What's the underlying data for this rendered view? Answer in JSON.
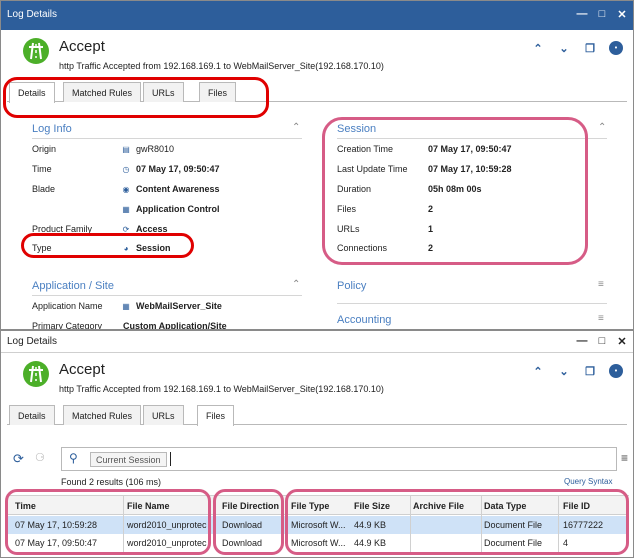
{
  "window1": {
    "title": "Log Details",
    "header": {
      "title": "Accept",
      "subtitle": "http Traffic Accepted from 192.168.169.1 to WebMailServer_Site(192.168.170.10)"
    },
    "tabs": [
      {
        "label": "Details",
        "active": true
      },
      {
        "label": "Matched Rules"
      },
      {
        "label": "URLs"
      },
      {
        "label": "Files"
      }
    ],
    "log_info": {
      "heading": "Log Info",
      "rows": [
        {
          "label": "Origin",
          "value": "gwR8010",
          "icon": "gateway-icon"
        },
        {
          "label": "Time",
          "value": "07 May 17, 09:50:47",
          "icon": "clock-icon"
        },
        {
          "label": "Blade",
          "value": "Content Awareness",
          "icon": "content-awareness-icon"
        },
        {
          "label": "",
          "value": "Application Control",
          "icon": "application-control-icon"
        },
        {
          "label": "Product Family",
          "value": "Access",
          "icon": "access-icon"
        },
        {
          "label": "Type",
          "value": "Session",
          "icon": "session-icon"
        }
      ]
    },
    "session": {
      "heading": "Session",
      "rows": [
        {
          "label": "Creation Time",
          "value": "07 May 17, 09:50:47"
        },
        {
          "label": "Last Update Time",
          "value": "07 May 17, 10:59:28"
        },
        {
          "label": "Duration",
          "value": "05h 08m 00s"
        },
        {
          "label": "Files",
          "value": "2"
        },
        {
          "label": "URLs",
          "value": "1"
        },
        {
          "label": "Connections",
          "value": "2"
        }
      ]
    },
    "app_site": {
      "heading": "Application / Site",
      "rows": [
        {
          "label": "Application Name",
          "value": "WebMailServer_Site"
        },
        {
          "label": "Primary Category",
          "value": "Custom Application/Site"
        }
      ]
    },
    "policy": {
      "heading": "Policy"
    },
    "accounting": {
      "heading": "Accounting"
    }
  },
  "window2": {
    "title": "Log Details",
    "header": {
      "title": "Accept",
      "subtitle": "http Traffic Accepted from 192.168.169.1 to WebMailServer_Site(192.168.170.10)"
    },
    "tabs": [
      {
        "label": "Details"
      },
      {
        "label": "Matched Rules"
      },
      {
        "label": "URLs"
      },
      {
        "label": "Files",
        "active": true
      }
    ],
    "search": {
      "chip": "Current Session",
      "value": ""
    },
    "results": "Found 2 results (106 ms)",
    "query_syntax": "Query Syntax",
    "columns": [
      "Time",
      "File Name",
      "File Direction",
      "File Type",
      "File Size",
      "Archive File",
      "Data Type",
      "File ID"
    ],
    "rows": [
      [
        "07 May 17, 10:59:28",
        "word2010_unprotec",
        "Download",
        "Microsoft W...",
        "44.9 KB",
        "",
        "Document File",
        "16777222"
      ],
      [
        "07 May 17, 09:50:47",
        "word2010_unprotec",
        "Download",
        "Microsoft W...",
        "44.9 KB",
        "",
        "Document File",
        "4"
      ]
    ]
  },
  "colors": {
    "titlebar": "#2d5e9b",
    "accent": "#4a7fc1",
    "logo": "#4caf29",
    "annotation_red": "#e00000",
    "annotation_pink": "#d65c86",
    "selected_row": "#cfe2f7"
  }
}
